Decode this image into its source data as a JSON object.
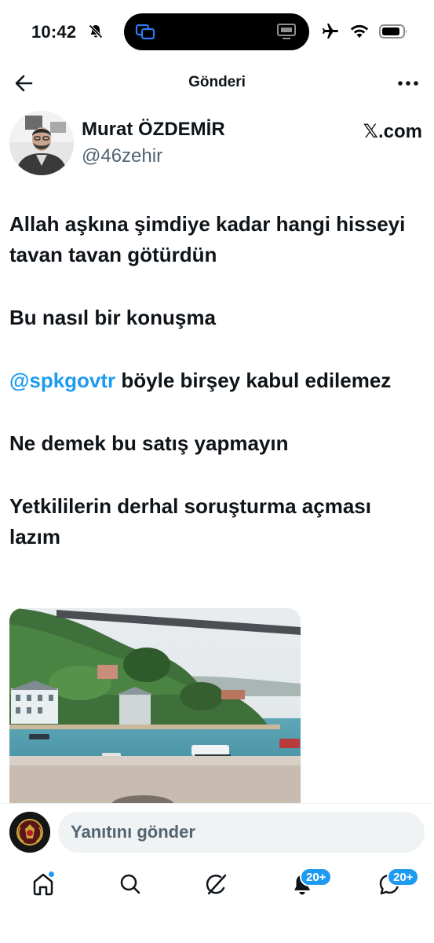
{
  "status_bar": {
    "time": "10:42"
  },
  "nav": {
    "title": "Gönderi"
  },
  "author": {
    "name": "Murat ÖZDEMİR",
    "handle": "@46zehir",
    "source": ".com",
    "source_logo": "𝕏"
  },
  "tweet": {
    "lines": [
      "Allah aşkına şimdiye kadar hangi hisseyi tavan tavan götürdün",
      "Bu nasıl bir konuşma",
      "böyle birşey kabul edilemez",
      "Ne demek bu satış yapmayın",
      "Yetkililerin derhal soruşturma açması lazım"
    ],
    "mention": "@spkgovtr"
  },
  "reply": {
    "placeholder": "Yanıtını gönder"
  },
  "tabs": {
    "notifications_badge": "20+",
    "messages_badge": "20+"
  },
  "colors": {
    "accent": "#1d9bf0",
    "text": "#0f1419",
    "secondary": "#536471",
    "input_bg": "#eff3f4"
  },
  "icons": [
    "bell-slash-icon",
    "airplane-icon",
    "wifi-icon",
    "battery-icon",
    "back-arrow-icon",
    "more-icon",
    "home-icon",
    "search-icon",
    "grok-icon",
    "notifications-icon",
    "messages-icon"
  ]
}
